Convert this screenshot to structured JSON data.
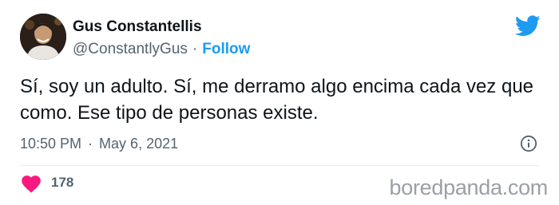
{
  "tweet": {
    "author_name": "Gus Constantellis",
    "handle": "@ConstantlyGus",
    "separator": "·",
    "follow_label": "Follow",
    "text": "Sí, soy un adulto. Sí, me derramo algo encima cada vez que como. Ese tipo de personas existe.",
    "time": "10:50 PM",
    "date": "May 6, 2021",
    "likes": "178"
  },
  "icons": {
    "brand": "twitter-bird-icon",
    "info": "info-icon",
    "like": "heart-icon"
  },
  "colors": {
    "accent": "#1d9bf0",
    "heart": "#f91880",
    "muted": "#536471",
    "text": "#0f1419"
  },
  "watermark": "boredpanda.com"
}
